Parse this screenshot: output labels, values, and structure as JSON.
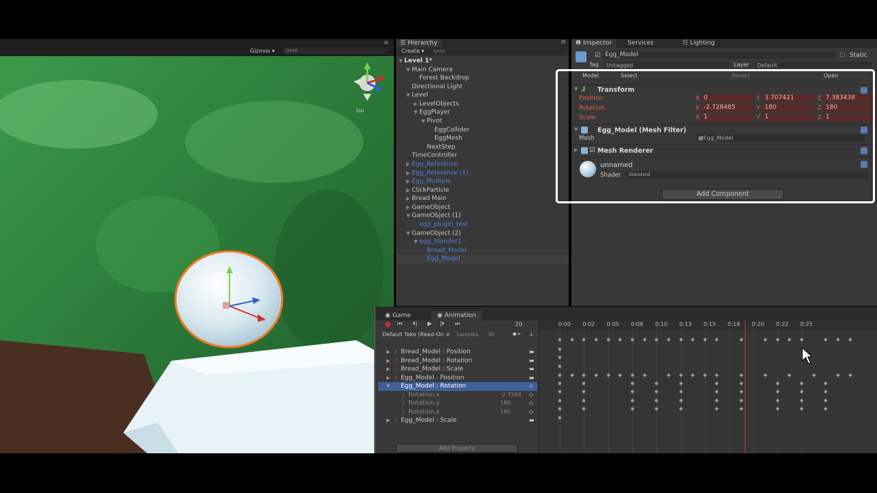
{
  "colors": {
    "scene_green": "#2f7a3c",
    "selection_blue": "#3d5f9a",
    "prefab_blue": "#4d7fde",
    "playhead_red": "#d03030",
    "highlight_white": "#ffffff"
  },
  "scene": {
    "gizmos_label": "Gizmos ▾",
    "search_placeholder": "Q▾All",
    "iso_label": "Iso",
    "menu_icon": "≡"
  },
  "hierarchy": {
    "tab_label": "Hierarchy",
    "create_label": "Create ▾",
    "search_placeholder": "Q▾All",
    "items": [
      {
        "label": "Level 1*",
        "indent": 0,
        "arrow": "▼",
        "kind": "scene"
      },
      {
        "label": "Main Camera",
        "indent": 1,
        "arrow": "▼",
        "kind": "normal"
      },
      {
        "label": "Forest Backdrop",
        "indent": 2,
        "arrow": "",
        "kind": "normal"
      },
      {
        "label": "Directional Light",
        "indent": 1,
        "arrow": "",
        "kind": "normal"
      },
      {
        "label": "Level",
        "indent": 1,
        "arrow": "▼",
        "kind": "normal"
      },
      {
        "label": "LevelObjects",
        "indent": 2,
        "arrow": "▶",
        "kind": "normal"
      },
      {
        "label": "EggPlayer",
        "indent": 2,
        "arrow": "▼",
        "kind": "normal"
      },
      {
        "label": "Pivot",
        "indent": 3,
        "arrow": "▼",
        "kind": "normal"
      },
      {
        "label": "EggCollider",
        "indent": 4,
        "arrow": "",
        "kind": "normal"
      },
      {
        "label": "EggMesh",
        "indent": 4,
        "arrow": "",
        "kind": "normal"
      },
      {
        "label": "NextStep",
        "indent": 3,
        "arrow": "",
        "kind": "normal"
      },
      {
        "label": "TimeController",
        "indent": 1,
        "arrow": "",
        "kind": "normal"
      },
      {
        "label": "Egg_Reference",
        "indent": 1,
        "arrow": "▶",
        "kind": "prefab"
      },
      {
        "label": "Egg_Reference (1)",
        "indent": 1,
        "arrow": "▶",
        "kind": "prefab"
      },
      {
        "label": "Egg_Multiple",
        "indent": 1,
        "arrow": "▶",
        "kind": "prefab"
      },
      {
        "label": "ClickParticle",
        "indent": 1,
        "arrow": "▶",
        "kind": "normal"
      },
      {
        "label": "Bread Main",
        "indent": 1,
        "arrow": "▶",
        "kind": "normal"
      },
      {
        "label": "GameObject",
        "indent": 1,
        "arrow": "▶",
        "kind": "normal"
      },
      {
        "label": "GameObject (1)",
        "indent": 1,
        "arrow": "▼",
        "kind": "normal"
      },
      {
        "label": "egg_plugin_test",
        "indent": 2,
        "arrow": "",
        "kind": "prefab"
      },
      {
        "label": "GameObject (2)",
        "indent": 1,
        "arrow": "▼",
        "kind": "normal"
      },
      {
        "label": "egg_blender1",
        "indent": 2,
        "arrow": "▼",
        "kind": "prefab"
      },
      {
        "label": "Bread_Model",
        "indent": 3,
        "arrow": "",
        "kind": "prefab"
      },
      {
        "label": "Egg_Model",
        "indent": 3,
        "arrow": "",
        "kind": "prefab-selected"
      }
    ]
  },
  "inspector": {
    "tabs": [
      "Inspector",
      "Services",
      "Lighting"
    ],
    "object_name": "Egg_Model",
    "static_label": "Static",
    "tag_label": "Tag",
    "tag_value": "Untagged",
    "layer_label": "Layer",
    "layer_value": "Default",
    "model_label": "Model",
    "select_label": "Select",
    "revert_label": "Revert",
    "open_label": "Open",
    "transform": {
      "title": "Transform",
      "position_label": "Position",
      "rotation_label": "Rotation",
      "scale_label": "Scale",
      "position": {
        "x": "0",
        "y": "3.707421",
        "z": "7.383438"
      },
      "rotation": {
        "x": "-2.728485",
        "y": "180",
        "z": "180"
      },
      "scale": {
        "x": "1",
        "y": "1",
        "z": "1"
      }
    },
    "mesh_filter": {
      "title": "Egg_Model (Mesh Filter)",
      "mesh_label": "Mesh",
      "mesh_value": "Egg_Model"
    },
    "mesh_renderer": {
      "title": "Mesh Renderer"
    },
    "material": {
      "name": "unnamed",
      "shader_label": "Shader",
      "shader_value": "Standard"
    },
    "add_component_label": "Add Component"
  },
  "animation": {
    "tabs": [
      "Game",
      "Animation"
    ],
    "frame_value": "20",
    "clip_name": "Default Take (Read-On ≑",
    "samples_label": "Samples",
    "samples_value": "30",
    "properties": [
      {
        "label": "Bread_Model : Position",
        "kind": "group",
        "ctrl": "▬"
      },
      {
        "label": "Bread_Model : Rotation",
        "kind": "group",
        "ctrl": "▬"
      },
      {
        "label": "Bread_Model : Scale",
        "kind": "group",
        "ctrl": "▬"
      },
      {
        "label": "Egg_Model : Position",
        "kind": "group",
        "ctrl": "▬"
      },
      {
        "label": "Egg_Model : Rotation",
        "kind": "group-selected",
        "ctrl": "◇"
      },
      {
        "label": "Rotation.x",
        "kind": "sub",
        "value": "-2.7284",
        "ctrl": "◇"
      },
      {
        "label": "Rotation.y",
        "kind": "sub",
        "value": "180",
        "ctrl": "◇"
      },
      {
        "label": "Rotation.z",
        "kind": "sub",
        "value": "180",
        "ctrl": "◇"
      },
      {
        "label": "Egg_Model : Scale",
        "kind": "group",
        "ctrl": "▬"
      }
    ],
    "add_property_label": "Add Property",
    "ruler_labels": [
      "0:00",
      "0:02",
      "0:05",
      "0:08",
      "0:10",
      "0:13",
      "0:15",
      "0:18",
      "0:20",
      "0:22",
      "0:25"
    ],
    "playhead_time": "0:20"
  }
}
